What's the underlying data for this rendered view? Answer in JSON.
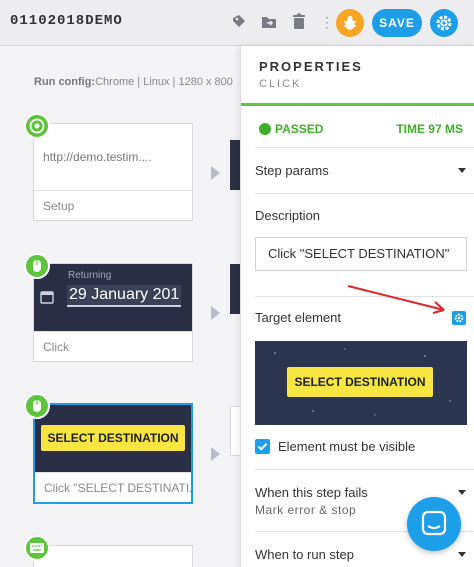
{
  "header": {
    "test_name": "01102018DEMO",
    "save_label": "SAVE",
    "icons": [
      "tag-icon",
      "folder-move-icon",
      "trash-icon",
      "more-vertical-icon",
      "bug-icon",
      "gear-icon"
    ],
    "accent_color": "#1c9ee8",
    "bug_color": "#f5a623"
  },
  "run_config": {
    "label": "Run config:",
    "value": "Chrome | Linux | 1280 x 800"
  },
  "steps": [
    {
      "thumb_text": "http://demo.testim....",
      "caption": "Setup",
      "icon": "chrome-icon"
    },
    {
      "thumb_small": "Returning",
      "thumb_date": "29 January 201",
      "caption": "Click",
      "icon": "mouse-icon"
    },
    {
      "thumb_button": "SELECT DESTINATION",
      "caption": "Click \"SELECT DESTINATI...",
      "icon": "mouse-icon",
      "selected": true
    },
    {
      "icon": "keyboard-icon"
    }
  ],
  "panel": {
    "title": "PROPERTIES",
    "subtitle": "CLICK",
    "status": "PASSED",
    "time": "TIME 97 MS",
    "step_params": "Step params",
    "description_label": "Description",
    "description_value": "Click \"SELECT DESTINATION\"",
    "target_element_label": "Target element",
    "target_preview_text": "SELECT DESTINATION",
    "visible_checkbox_label": "Element must be visible",
    "visible_checked": true,
    "when_fails_label": "When this step fails",
    "when_fails_value": "Mark error & stop",
    "when_run_label": "When to run step",
    "pass_color": "#3fae29"
  }
}
